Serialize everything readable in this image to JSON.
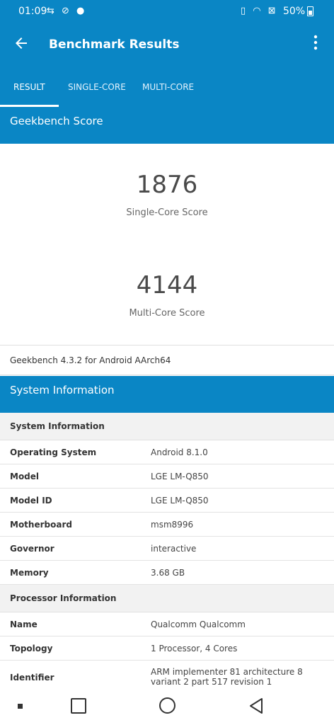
{
  "status": {
    "time": "01:09",
    "left_icons": "⇆ ⊘ ●",
    "right_icons": "▯ ◠ ⊠",
    "battery": "50%"
  },
  "appbar": {
    "back_icon": "arrow-back-icon",
    "title": "Benchmark Results",
    "more_icon": "more-vert-icon"
  },
  "tabs": [
    {
      "label": "RESULT",
      "active": true
    },
    {
      "label": "SINGLE-CORE",
      "active": false
    },
    {
      "label": "MULTI-CORE",
      "active": false
    }
  ],
  "geekbench": {
    "heading": "Geekbench Score",
    "single_value": "1876",
    "single_label": "Single-Core Score",
    "multi_value": "4144",
    "multi_label": "Multi-Core Score",
    "version": "Geekbench 4.3.2 for Android AArch64"
  },
  "system": {
    "heading": "System Information",
    "group1": "System Information",
    "rows1": [
      {
        "key": "Operating System",
        "value": "Android 8.1.0"
      },
      {
        "key": "Model",
        "value": "LGE LM-Q850"
      },
      {
        "key": "Model ID",
        "value": "LGE LM-Q850"
      },
      {
        "key": "Motherboard",
        "value": "msm8996"
      },
      {
        "key": "Governor",
        "value": "interactive"
      },
      {
        "key": "Memory",
        "value": "3.68 GB"
      }
    ],
    "group2": "Processor Information",
    "rows2": [
      {
        "key": "Name",
        "value": "Qualcomm Qualcomm"
      },
      {
        "key": "Topology",
        "value": "1 Processor, 4 Cores"
      },
      {
        "key": "Identifier",
        "value": "ARM implementer 81 architecture 8 variant 2 part 517 revision 1"
      }
    ]
  },
  "colors": {
    "primary": "#0a86c5",
    "group_bg": "#f2f2f2"
  }
}
